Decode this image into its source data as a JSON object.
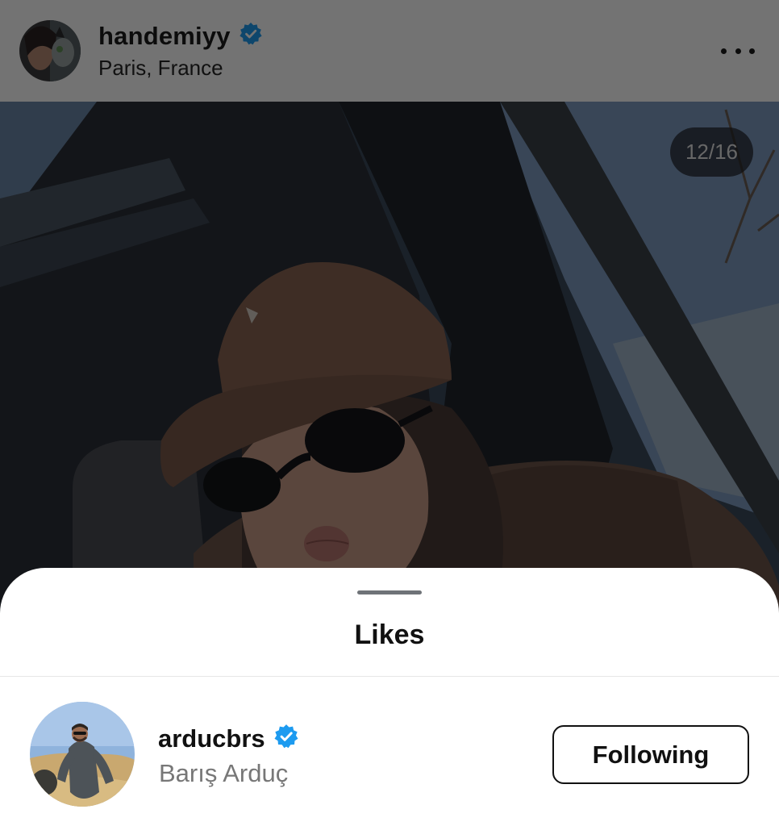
{
  "post": {
    "username": "handemiyy",
    "location": "Paris, France",
    "photo_counter": "12/16",
    "verified_icon": "verified-badge-icon",
    "more_icon": "more-options-icon"
  },
  "likes_sheet": {
    "title": "Likes",
    "items": [
      {
        "username": "arducbrs",
        "full_name": "Barış Arduç",
        "verified": true,
        "button_label": "Following"
      }
    ]
  },
  "colors": {
    "verified_blue": "#1d9bf0",
    "overlay": "rgba(0,0,0,0.55)",
    "secondary_text": "#777777"
  }
}
